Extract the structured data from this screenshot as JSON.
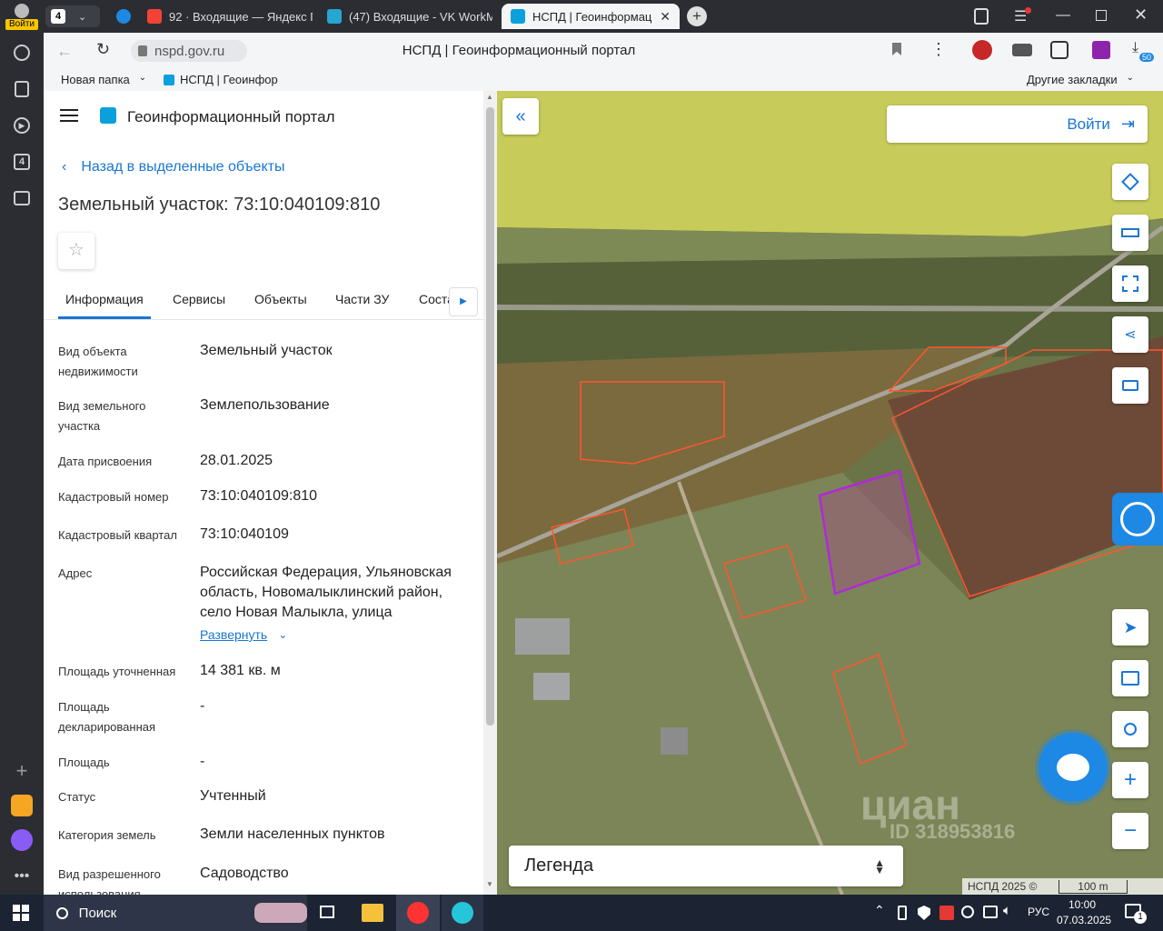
{
  "browser": {
    "profile_label": "Войти",
    "tab_count": "4",
    "tabs": [
      {
        "label": "92 · Входящие — Яндекс П"
      },
      {
        "label": "(47) Входящие - VK WorkM"
      },
      {
        "label": "НСПД | Геоинформаци"
      }
    ],
    "address": "nspd.gov.ru",
    "page_title": "НСПД | Геоинформационный портал",
    "downloads_badge": "50",
    "bookmarks": [
      {
        "label": "Новая папка"
      },
      {
        "label": "НСПД | Геоинфор"
      }
    ],
    "other_bookmarks": "Другие закладки",
    "sidebar_badge": "4"
  },
  "panel": {
    "portal_title": "Геоинформационный портал",
    "back_link": "Назад в выделенные объекты",
    "object_title": "Земельный участок: 73:10:040109:810",
    "tabs": [
      {
        "label": "Информация"
      },
      {
        "label": "Сервисы"
      },
      {
        "label": "Объекты"
      },
      {
        "label": "Части ЗУ"
      },
      {
        "label": "Соста"
      }
    ],
    "fields": [
      {
        "label": "Вид объекта недвижимости",
        "value": "Земельный участок"
      },
      {
        "label": "Вид земельного участка",
        "value": "Землепользование"
      },
      {
        "label": "Дата присвоения",
        "value": "28.01.2025"
      },
      {
        "label": "Кадастровый номер",
        "value": "73:10:040109:810"
      },
      {
        "label": "Кадастровый квартал",
        "value": "73:10:040109"
      },
      {
        "label": "Адрес",
        "value": "Российская Федерация, Ульяновская область, Новомалыклинский район, село Новая Малыкла, улица"
      },
      {
        "label": "Площадь уточненная",
        "value": "14 381 кв. м"
      },
      {
        "label": "Площадь декларированная",
        "value": "-"
      },
      {
        "label": "Площадь",
        "value": "-"
      },
      {
        "label": "Статус",
        "value": "Учтенный"
      },
      {
        "label": "Категория земель",
        "value": "Земли населенных пунктов"
      },
      {
        "label": "Вид разрешенного использования",
        "value": "Садоводство"
      }
    ],
    "expand_link": "Развернуть"
  },
  "map": {
    "login_label": "Войти",
    "legend_label": "Легенда",
    "copyright": "НСПД 2025 ©",
    "scale_label": "100 m",
    "watermark": "циан",
    "watermark_id": "ID 318953816"
  },
  "taskbar": {
    "search_placeholder": "Поиск",
    "lang": "РУС",
    "time": "10:00",
    "date": "07.03.2025",
    "notif_count": "1"
  }
}
